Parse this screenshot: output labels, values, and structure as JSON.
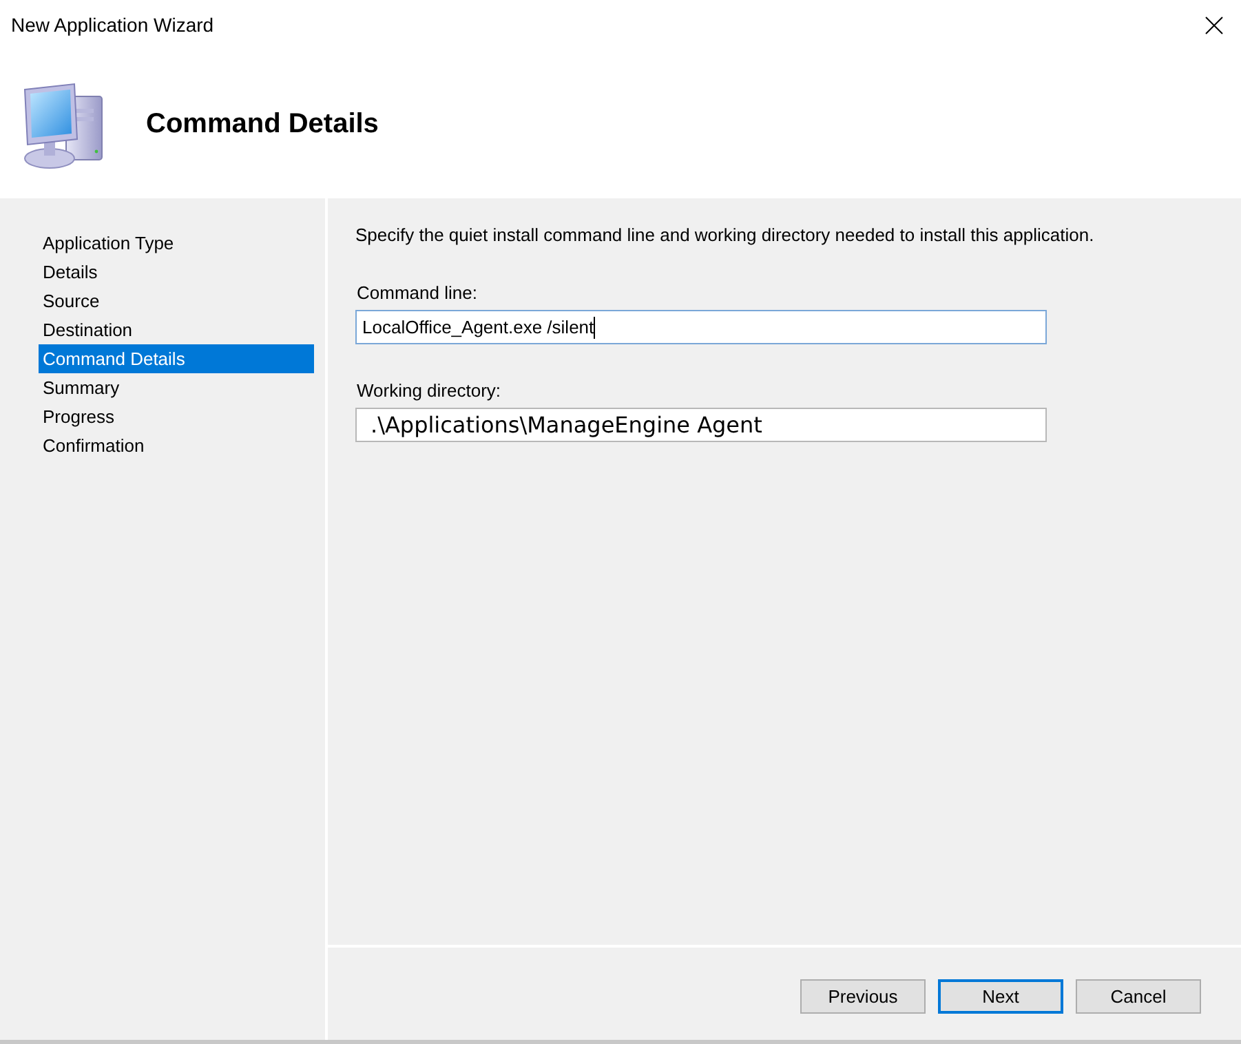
{
  "window": {
    "title": "New Application Wizard"
  },
  "header": {
    "title": "Command Details"
  },
  "sidebar": {
    "items": [
      {
        "label": "Application Type",
        "selected": false
      },
      {
        "label": "Details",
        "selected": false
      },
      {
        "label": "Source",
        "selected": false
      },
      {
        "label": "Destination",
        "selected": false
      },
      {
        "label": "Command Details",
        "selected": true
      },
      {
        "label": "Summary",
        "selected": false
      },
      {
        "label": "Progress",
        "selected": false
      },
      {
        "label": "Confirmation",
        "selected": false
      }
    ]
  },
  "content": {
    "description": "Specify the quiet install command line and working directory needed to install this application.",
    "fields": [
      {
        "label": "Command line:",
        "value": "LocalOffice_Agent.exe /silent",
        "focused": true,
        "large_text": false
      },
      {
        "label": "Working directory:",
        "value": ".\\Applications\\ManageEngine Agent",
        "focused": false,
        "large_text": true
      }
    ]
  },
  "buttons": [
    {
      "label": "Previous",
      "default": false
    },
    {
      "label": "Next",
      "default": true
    },
    {
      "label": "Cancel",
      "default": false
    }
  ]
}
